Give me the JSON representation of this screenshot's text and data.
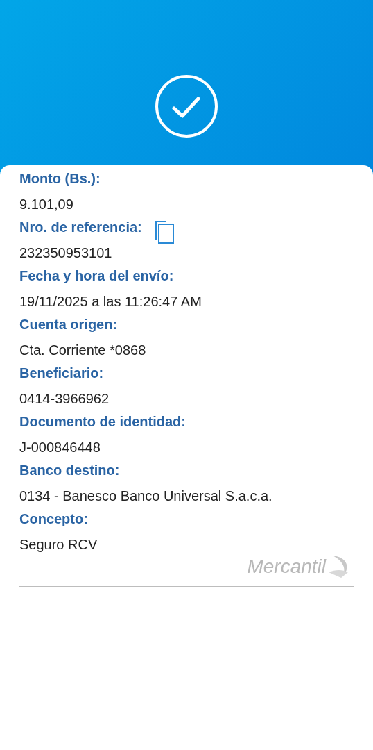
{
  "fields": [
    {
      "label": "Monto (Bs.):",
      "value": "9.101,09",
      "copyable": false
    },
    {
      "label": "Nro. de referencia:",
      "value": "232350953101",
      "copyable": true
    },
    {
      "label": "Fecha y hora del envío:",
      "value": "19/11/2025 a las 11:26:47 AM",
      "copyable": false
    },
    {
      "label": "Cuenta origen:",
      "value": "Cta. Corriente *0868",
      "copyable": false
    },
    {
      "label": "Beneficiario:",
      "value": "0414-3966962",
      "copyable": false
    },
    {
      "label": "Documento de identidad:",
      "value": "J-000846448",
      "copyable": false
    },
    {
      "label": "Banco destino:",
      "value": "0134 - Banesco Banco Universal S.a.c.a.",
      "copyable": false
    },
    {
      "label": "Concepto:",
      "value": "Seguro RCV",
      "copyable": false
    }
  ],
  "logo": {
    "text": "Mercantil"
  }
}
